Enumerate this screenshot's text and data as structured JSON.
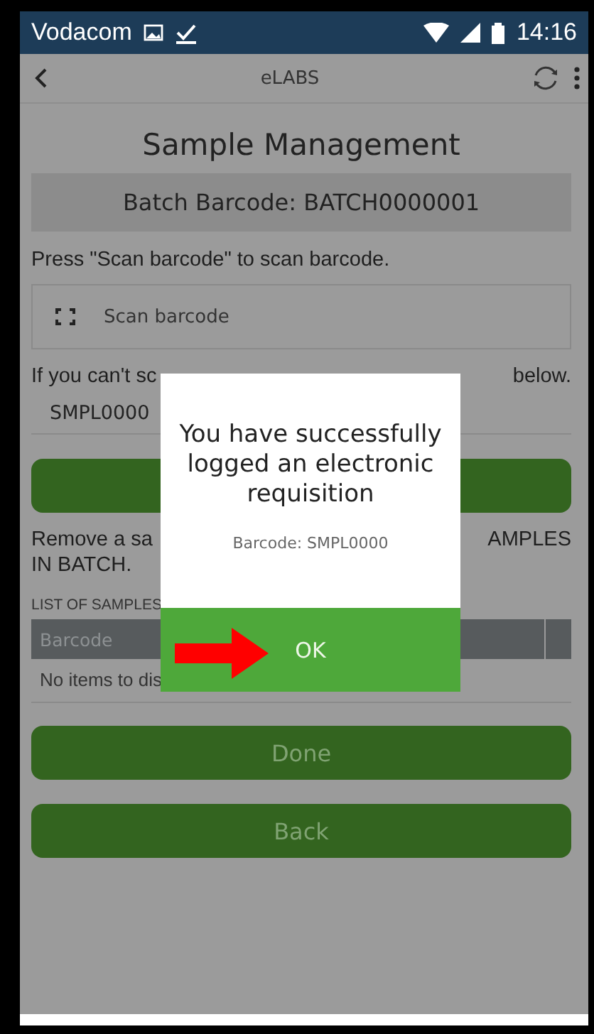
{
  "status_bar": {
    "carrier": "Vodacom",
    "time": "14:16"
  },
  "app_bar": {
    "title": "eLABS"
  },
  "page": {
    "title": "Sample Management",
    "batch_label": "Batch Barcode: BATCH0000001",
    "scan_hint": "Press \"Scan barcode\" to scan barcode.",
    "scan_button": "Scan barcode",
    "manual_hint_left": "If you can't sc",
    "manual_hint_right": "below.",
    "barcode_value": "SMPL0000",
    "remove_hint_left": "Remove a sa",
    "remove_hint_right": "AMPLES",
    "remove_hint_line_2": "IN BATCH.",
    "list_label": "LIST OF SAMPLES",
    "table": {
      "columns": [
        "Barcode"
      ],
      "empty_text": "No items to dis"
    },
    "buttons": [
      {
        "label": "Done"
      },
      {
        "label": "Back"
      }
    ]
  },
  "dialog": {
    "message": "You have successfully logged an electronic requisition",
    "detail": "Barcode: SMPL0000",
    "ok": "OK"
  }
}
